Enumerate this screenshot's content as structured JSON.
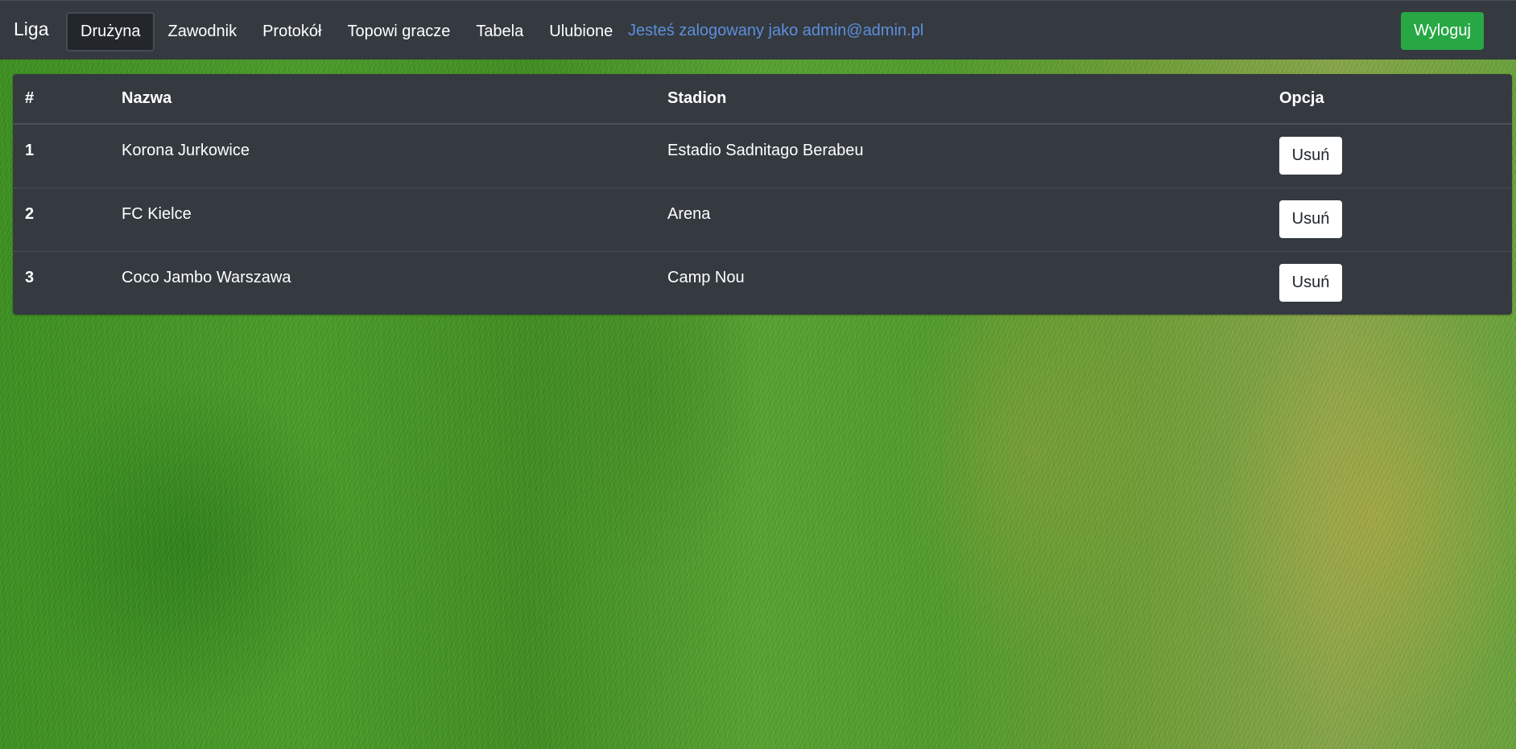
{
  "navbar": {
    "brand": "Liga",
    "links": [
      "Drużyna",
      "Zawodnik",
      "Protokół",
      "Topowi gracze",
      "Tabela",
      "Ulubione"
    ],
    "active_index": 0,
    "logged_in_text": "Jesteś zalogowany jako admin@admin.pl",
    "logout_label": "Wyloguj"
  },
  "table": {
    "headers": [
      "#",
      "Nazwa",
      "Stadion",
      "Opcja"
    ],
    "rows": [
      {
        "index": "1",
        "name": "Korona Jurkowice",
        "stadium": "Estadio Sadnitago Berabeu",
        "action": "Usuń"
      },
      {
        "index": "2",
        "name": "FC Kielce",
        "stadium": "Arena",
        "action": "Usuń"
      },
      {
        "index": "3",
        "name": "Coco Jambo Warszawa",
        "stadium": "Camp Nou",
        "action": "Usuń"
      }
    ]
  },
  "colors": {
    "navbar_bg": "#343a40",
    "active_link_bg": "#23272b",
    "logged_in_text": "#5e8edb",
    "logout_button": "#28a745",
    "table_bg": "#343a40"
  }
}
